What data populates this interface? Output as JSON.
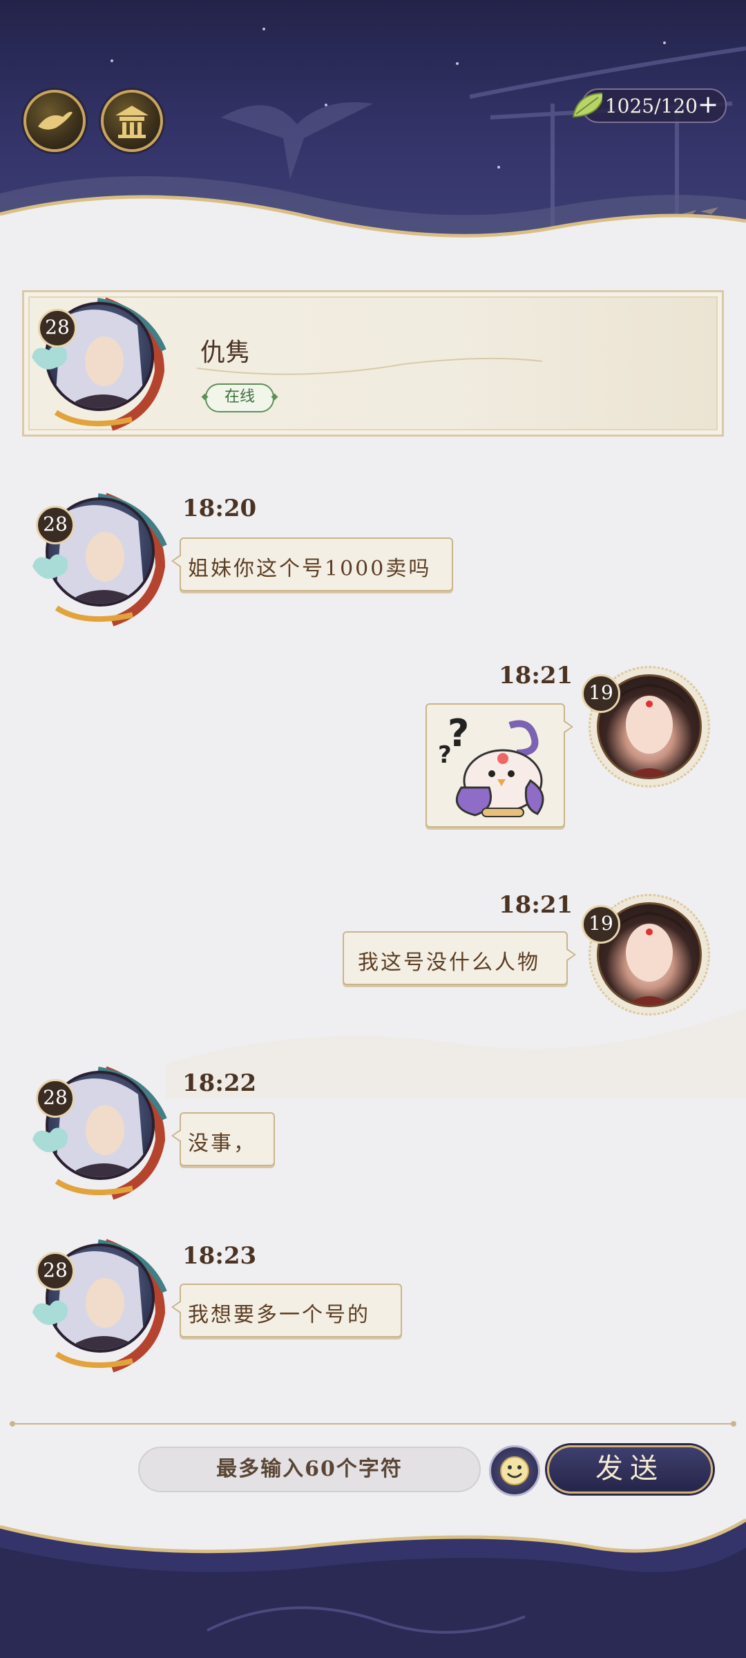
{
  "header": {
    "currency": {
      "amount": "1025/120",
      "icon": "leaf-icon",
      "add_icon": "plus-icon"
    },
    "buttons": [
      {
        "icon": "crane-emblem-icon"
      },
      {
        "icon": "pavilion-icon"
      }
    ]
  },
  "profile": {
    "name": "仇隽",
    "level": "28",
    "status": "在线"
  },
  "messages": [
    {
      "side": "left",
      "time": "18:20",
      "level": "28",
      "text": "姐妹你这个号1000卖吗"
    },
    {
      "side": "right",
      "time": "18:21",
      "level": "19",
      "sticker": "confused-bird-sticker"
    },
    {
      "side": "right",
      "time": "18:21",
      "level": "19",
      "text": "我这号没什么人物"
    },
    {
      "side": "left",
      "time": "18:22",
      "level": "28",
      "text": "没事，"
    },
    {
      "side": "left",
      "time": "18:23",
      "level": "28",
      "text": "我想要多一个号的"
    }
  ],
  "composer": {
    "placeholder": "最多输入60个字符",
    "send_label": "发送",
    "emoji_icon": "smiley-icon"
  },
  "colors": {
    "navy": "#2e2e5c",
    "gold": "#c9b48c",
    "text_brown": "#5b3d22",
    "online_green": "#5e8f5a"
  }
}
